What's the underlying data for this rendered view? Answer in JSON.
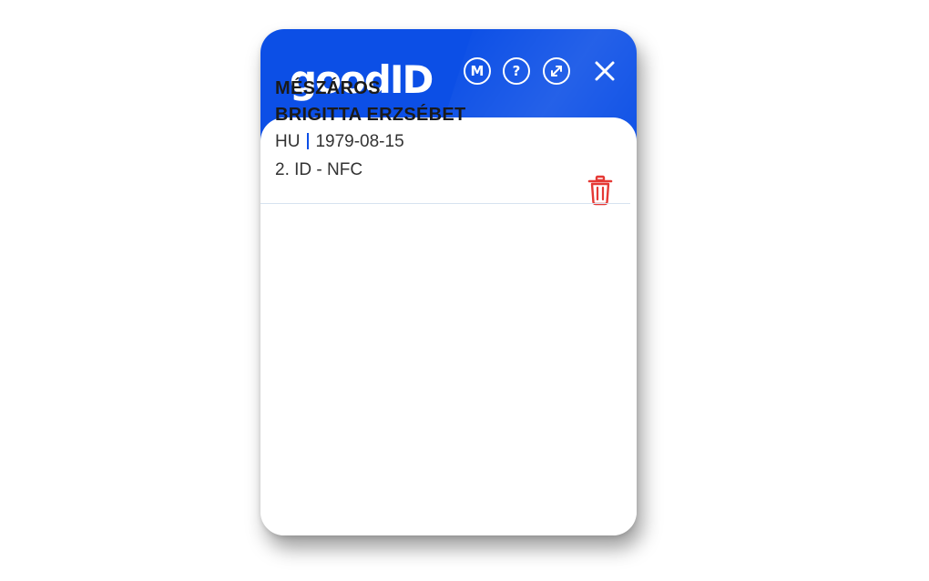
{
  "header": {
    "logo_text": "goodID",
    "brand_color": "#0c4fe6",
    "buttons": [
      {
        "name": "m-button",
        "label": "M"
      },
      {
        "name": "help-button",
        "label": "?"
      },
      {
        "name": "expand-button",
        "icon": "expand-arrows-icon"
      }
    ],
    "close_icon": "close-icon"
  },
  "identities": [
    {
      "last_name": "MÉSZÁROS",
      "first_names": "BRIGITTA ERZSÉBET",
      "country": "HU",
      "birth_date": "1979-08-15",
      "document": "2. ID - NFC",
      "delete_icon": "trash-icon",
      "delete_color": "#e53935"
    }
  ]
}
